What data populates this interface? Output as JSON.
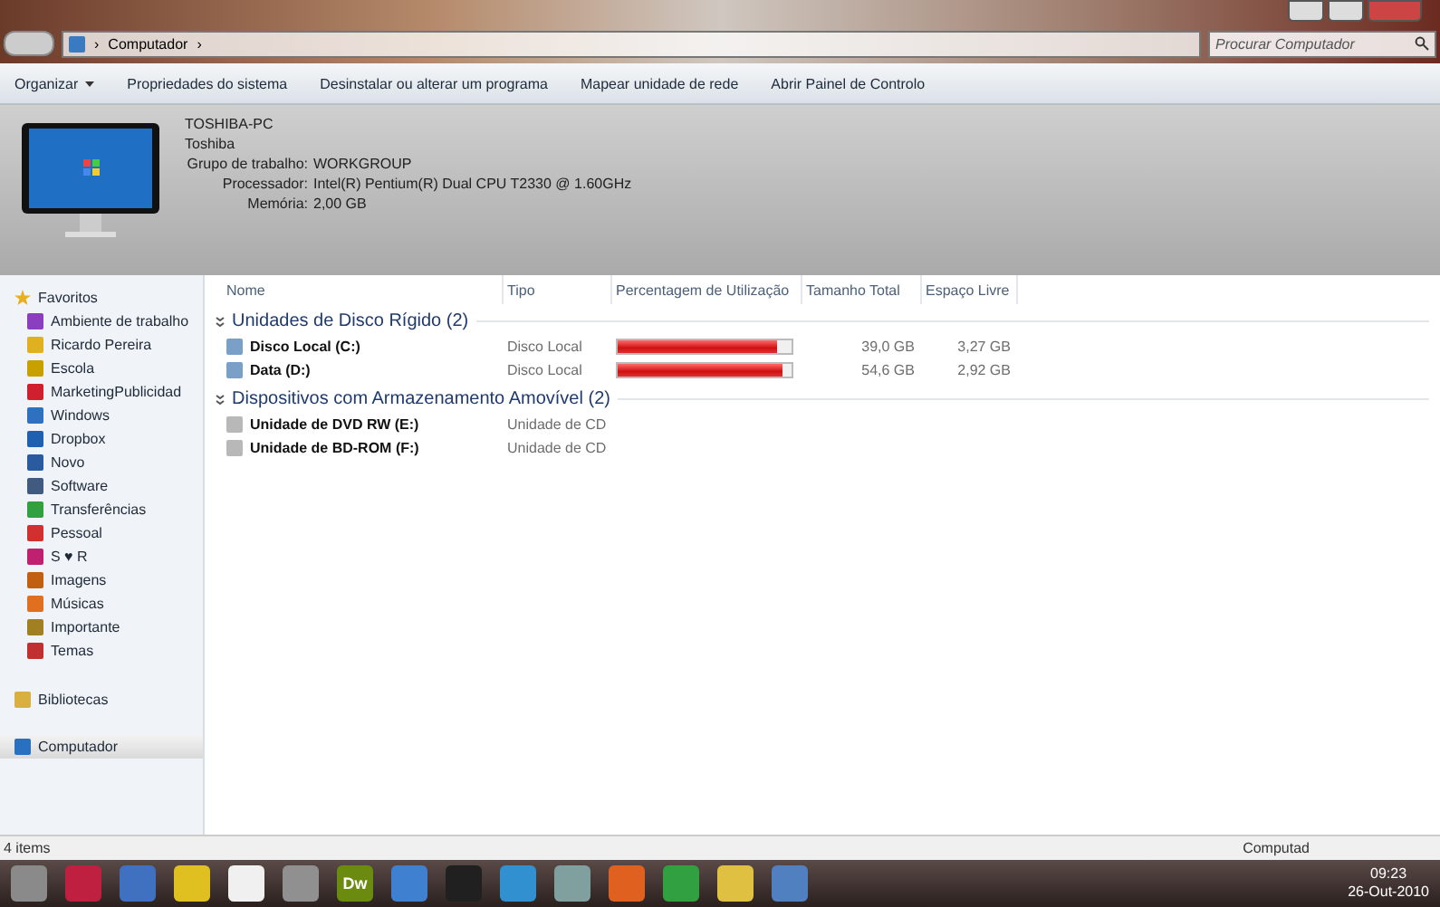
{
  "address_bar": {
    "path": "Computador",
    "separator": "›",
    "search_placeholder": "Procurar Computador"
  },
  "command_bar": {
    "items": [
      {
        "label": "Organizar",
        "dropdown": true
      },
      {
        "label": "Propriedades do sistema",
        "dropdown": false
      },
      {
        "label": "Desinstalar ou alterar um programa",
        "dropdown": false
      },
      {
        "label": "Mapear unidade de rede",
        "dropdown": false
      },
      {
        "label": "Abrir Painel de Controlo",
        "dropdown": false
      }
    ]
  },
  "details": {
    "name": "TOSHIBA-PC",
    "model": "Toshiba",
    "fields": [
      {
        "label": "Grupo de trabalho:",
        "value": "WORKGROUP"
      },
      {
        "label": "Processador:",
        "value": "Intel(R) Pentium(R) Dual  CPU  T2330  @ 1.60GHz"
      },
      {
        "label": "Memória:",
        "value": "2,00 GB"
      }
    ]
  },
  "sidebar": {
    "favorites": {
      "label": "Favoritos",
      "items": [
        {
          "label": "Ambiente de trabalho",
          "color": "#8a3fc0"
        },
        {
          "label": "Ricardo Pereira",
          "color": "#e0b020"
        },
        {
          "label": "Escola",
          "color": "#c8a000"
        },
        {
          "label": "MarketingPublicidad",
          "color": "#d02030"
        },
        {
          "label": "Windows",
          "color": "#3070c0"
        },
        {
          "label": "Dropbox",
          "color": "#2060b0"
        },
        {
          "label": "Novo",
          "color": "#2a5aa0"
        },
        {
          "label": "Software",
          "color": "#405a80"
        },
        {
          "label": "Transferências",
          "color": "#30a040"
        },
        {
          "label": "Pessoal",
          "color": "#d03030"
        },
        {
          "label": "S ♥ R",
          "color": "#c02070"
        },
        {
          "label": "Imagens",
          "color": "#c06010"
        },
        {
          "label": "Músicas",
          "color": "#e07020"
        },
        {
          "label": "Importante",
          "color": "#a08020"
        },
        {
          "label": "Temas",
          "color": "#c03030"
        }
      ]
    },
    "libraries": {
      "label": "Bibliotecas",
      "selected": false
    },
    "computer": {
      "label": "Computador",
      "selected": true
    }
  },
  "columns": [
    "Nome",
    "Tipo",
    "Percentagem de Utilização",
    "Tamanho Total",
    "Espaço Livre"
  ],
  "groups": [
    {
      "title": "Unidades de Disco Rígido (2)",
      "items": [
        {
          "kind": "drive",
          "name": "Disco Local (C:)",
          "type": "Disco Local",
          "level": 0.92,
          "total": "39,0 GB",
          "free": "3,27 GB"
        },
        {
          "kind": "drive",
          "name": "Data (D:)",
          "type": "Disco Local",
          "level": 0.95,
          "total": "54,6 GB",
          "free": "2,92 GB"
        }
      ]
    },
    {
      "title": "Dispositivos com Armazenamento Amovível (2)",
      "items": [
        {
          "kind": "optical",
          "name": "Unidade de DVD RW (E:)",
          "type": "Unidade de CD"
        },
        {
          "kind": "optical",
          "name": "Unidade de BD-ROM (F:)",
          "type": "Unidade de CD"
        }
      ]
    }
  ],
  "status_bar": {
    "count": "4 items",
    "location": "Computad"
  },
  "taskbar": {
    "apps": [
      {
        "kind": "square",
        "color": "#c02040"
      },
      {
        "kind": "square",
        "color": "#4070c0"
      },
      {
        "kind": "square",
        "color": "#e0c020"
      },
      {
        "kind": "square",
        "color": "#f0f0f0"
      },
      {
        "kind": "square",
        "color": "#909090"
      },
      {
        "kind": "label",
        "color": "#6a8a10",
        "label": "Dw"
      },
      {
        "kind": "square",
        "color": "#4080d0"
      },
      {
        "kind": "square",
        "color": "#202020"
      },
      {
        "kind": "square",
        "color": "#3090d0"
      },
      {
        "kind": "square",
        "color": "#80a0a0"
      },
      {
        "kind": "square",
        "color": "#e06020"
      },
      {
        "kind": "square",
        "color": "#30a040"
      },
      {
        "kind": "square",
        "color": "#e0c040"
      },
      {
        "kind": "square",
        "color": "#5080c0"
      }
    ],
    "time": "09:23",
    "date": "26-Out-2010"
  }
}
